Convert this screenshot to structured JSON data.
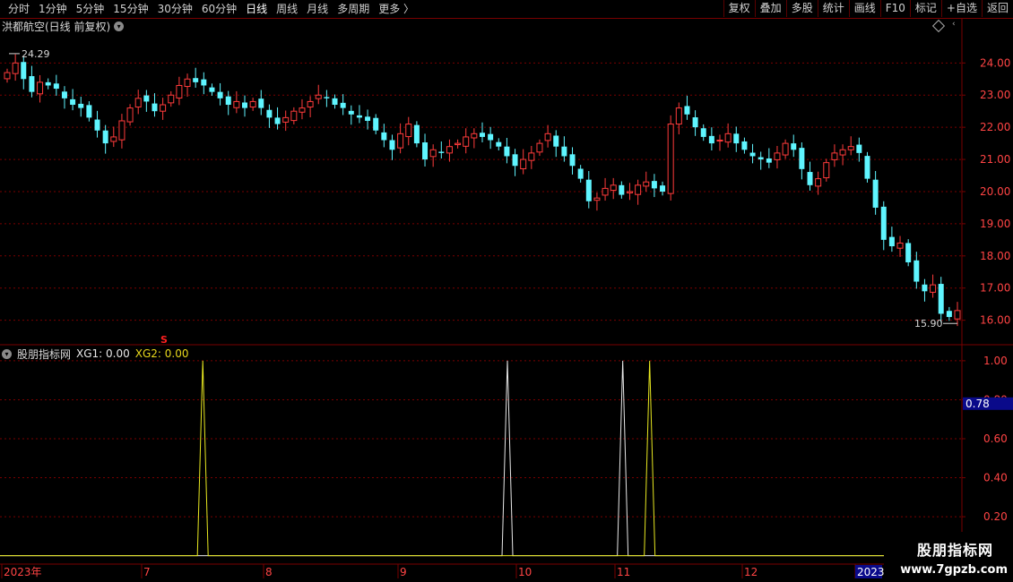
{
  "toolbar": {
    "periods": [
      "分时",
      "1分钟",
      "5分钟",
      "15分钟",
      "30分钟",
      "60分钟",
      "日线",
      "周线",
      "月线",
      "多周期",
      "更多 〉"
    ],
    "active_period": "日线",
    "actions": [
      "复权",
      "叠加",
      "多股",
      "统计",
      "画线",
      "F10",
      "标记",
      "+自选",
      "返回"
    ]
  },
  "stock": {
    "title": "洪都航空(日线 前复权)",
    "high_label": "24.29",
    "low_label": "15.90"
  },
  "indicator": {
    "name": "股朋指标网",
    "xg1_text": "XG1: 0.00",
    "xg2_text": "XG2: 0.00",
    "cursor_value": "0.78"
  },
  "watermark": {
    "line1": "股朋指标网",
    "line2": "www.7gpzb.com"
  },
  "colors": {
    "up": "#ff3b3b",
    "down": "#5ff5ff",
    "grid": "#7a0000",
    "axis_text": "#ff4444",
    "indicator_line": "#e8e820",
    "signal_marker": "#ff2020"
  },
  "chart_data": [
    {
      "type": "candlestick",
      "title": "洪都航空(日线 前复权)",
      "y_ticks": [
        16.0,
        17.0,
        18.0,
        19.0,
        20.0,
        21.0,
        22.0,
        23.0,
        24.0
      ],
      "ylim": [
        15.6,
        24.9
      ],
      "x_ticks": [
        "2023年",
        "7",
        "8",
        "9",
        "10",
        "11",
        "12",
        "2023"
      ],
      "grid": true,
      "max_label": 24.29,
      "min_label": 15.9,
      "signal_marker": "S",
      "close_series": [
        23.7,
        24.0,
        23.5,
        23.1,
        23.4,
        23.3,
        23.2,
        22.9,
        22.7,
        22.6,
        22.3,
        21.9,
        21.5,
        21.7,
        22.2,
        22.6,
        22.9,
        22.8,
        22.5,
        22.7,
        23.0,
        23.3,
        23.5,
        23.4,
        23.3,
        23.1,
        22.9,
        22.7,
        22.8,
        22.6,
        22.8,
        22.6,
        22.3,
        22.1,
        22.3,
        22.5,
        22.6,
        22.8,
        23.0,
        22.9,
        22.7,
        22.6,
        22.4,
        22.3,
        22.2,
        21.9,
        21.6,
        21.3,
        21.8,
        22.1,
        21.5,
        21.0,
        21.3,
        21.2,
        21.4,
        21.5,
        21.7,
        21.8,
        21.7,
        21.6,
        21.4,
        21.1,
        20.8,
        21.0,
        21.2,
        21.5,
        21.8,
        21.4,
        21.1,
        20.8,
        20.4,
        19.7,
        19.8,
        20.1,
        20.2,
        19.9,
        20.0,
        20.2,
        20.3,
        20.1,
        20.0,
        22.1,
        22.6,
        22.4,
        22.0,
        21.7,
        21.5,
        21.6,
        21.8,
        21.5,
        21.3,
        21.1,
        21.0,
        20.9,
        21.2,
        21.5,
        21.3,
        20.7,
        20.2,
        20.4,
        20.9,
        21.2,
        21.3,
        21.4,
        21.2,
        20.4,
        19.5,
        18.5,
        18.3,
        18.4,
        17.8,
        17.2,
        16.9,
        17.1,
        16.2,
        16.1,
        16.3
      ],
      "marker_values": [
        {
          "label": "24.29",
          "value": 24.29
        },
        {
          "label": "15.90",
          "value": 15.9
        }
      ]
    },
    {
      "type": "line",
      "title": "股朋指标网",
      "y_ticks": [
        0.2,
        0.4,
        0.6,
        0.8,
        1.0
      ],
      "ylim": [
        -0.02,
        1.05
      ],
      "series": [
        {
          "name": "XG1",
          "spikes_at_fraction_of_x": [
            0.528,
            0.648
          ]
        },
        {
          "name": "XG2",
          "spikes_at_fraction_of_x": [
            0.211,
            0.676
          ]
        }
      ],
      "spike_value": 1.0,
      "cursor_value": 0.78
    }
  ]
}
